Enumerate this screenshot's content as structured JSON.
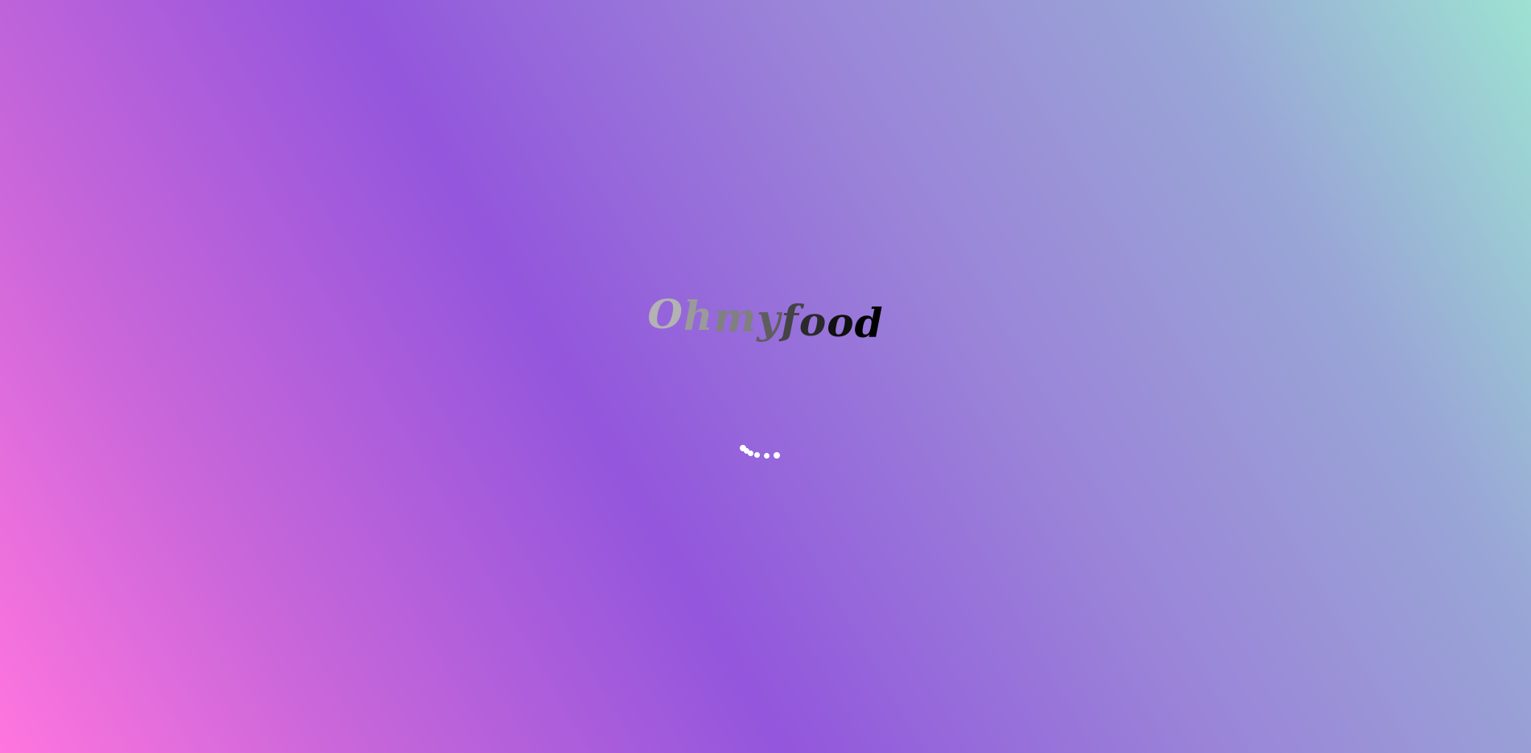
{
  "page": {
    "background_colors": [
      "#ff75de",
      "#9356dc",
      "#9de2d2"
    ]
  },
  "logo": {
    "text": "Ohmyfood",
    "letters": [
      {
        "char": "O",
        "color": "#b3b3b3",
        "offset_em": -0.12
      },
      {
        "char": "h",
        "color": "#9a9a9a",
        "offset_em": -0.08
      },
      {
        "char": "m",
        "color": "#808080",
        "offset_em": -0.04
      },
      {
        "char": "y",
        "color": "#5e5e5e",
        "offset_em": 0
      },
      {
        "char": "f",
        "color": "#444444",
        "offset_em": 0.02
      },
      {
        "char": "o",
        "color": "#2a2a2a",
        "offset_em": 0.06
      },
      {
        "char": "o",
        "color": "#111111",
        "offset_em": 0.08
      },
      {
        "char": "d",
        "color": "#000000",
        "offset_em": 0.1
      }
    ]
  },
  "loader": {
    "icon": "loading-dots-icon",
    "color": "#ffffff",
    "dot_count": 6
  }
}
